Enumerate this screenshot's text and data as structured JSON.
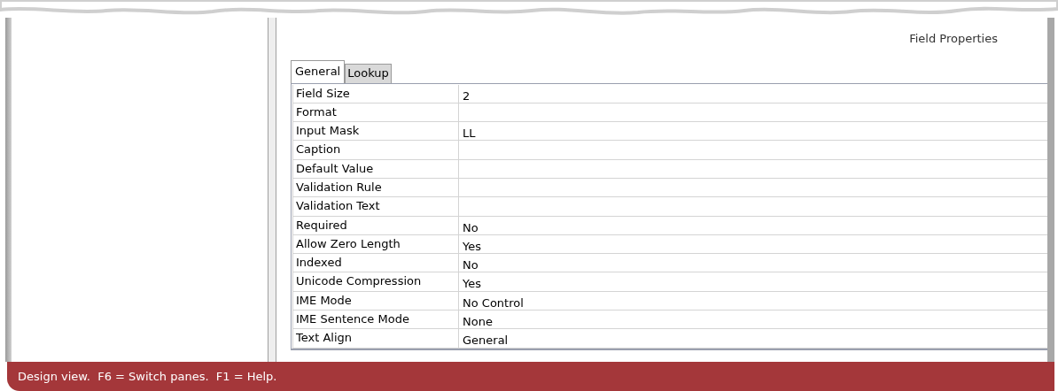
{
  "pane_title": "Field Properties",
  "tabs": [
    {
      "label": "General",
      "selected": true
    },
    {
      "label": "Lookup",
      "selected": false
    }
  ],
  "properties": [
    {
      "name": "Field Size",
      "value": "2"
    },
    {
      "name": "Format"
    },
    {
      "name": "Input Mask",
      "value": "LL"
    },
    {
      "name": "Caption"
    },
    {
      "name": "Default Value"
    },
    {
      "name": "Validation Rule"
    },
    {
      "name": "Validation Text"
    },
    {
      "name": "Required",
      "value": "No"
    },
    {
      "name": "Allow Zero Length",
      "value": "Yes"
    },
    {
      "name": "Indexed",
      "value": "No"
    },
    {
      "name": "Unicode Compression",
      "value": "Yes"
    },
    {
      "name": "IME Mode",
      "value": "No Control"
    },
    {
      "name": "IME Sentence Mode",
      "value": "None"
    },
    {
      "name": "Text Align",
      "value": "General"
    }
  ],
  "status_bar": "Design view.  F6 = Switch panes.  F1 = Help."
}
